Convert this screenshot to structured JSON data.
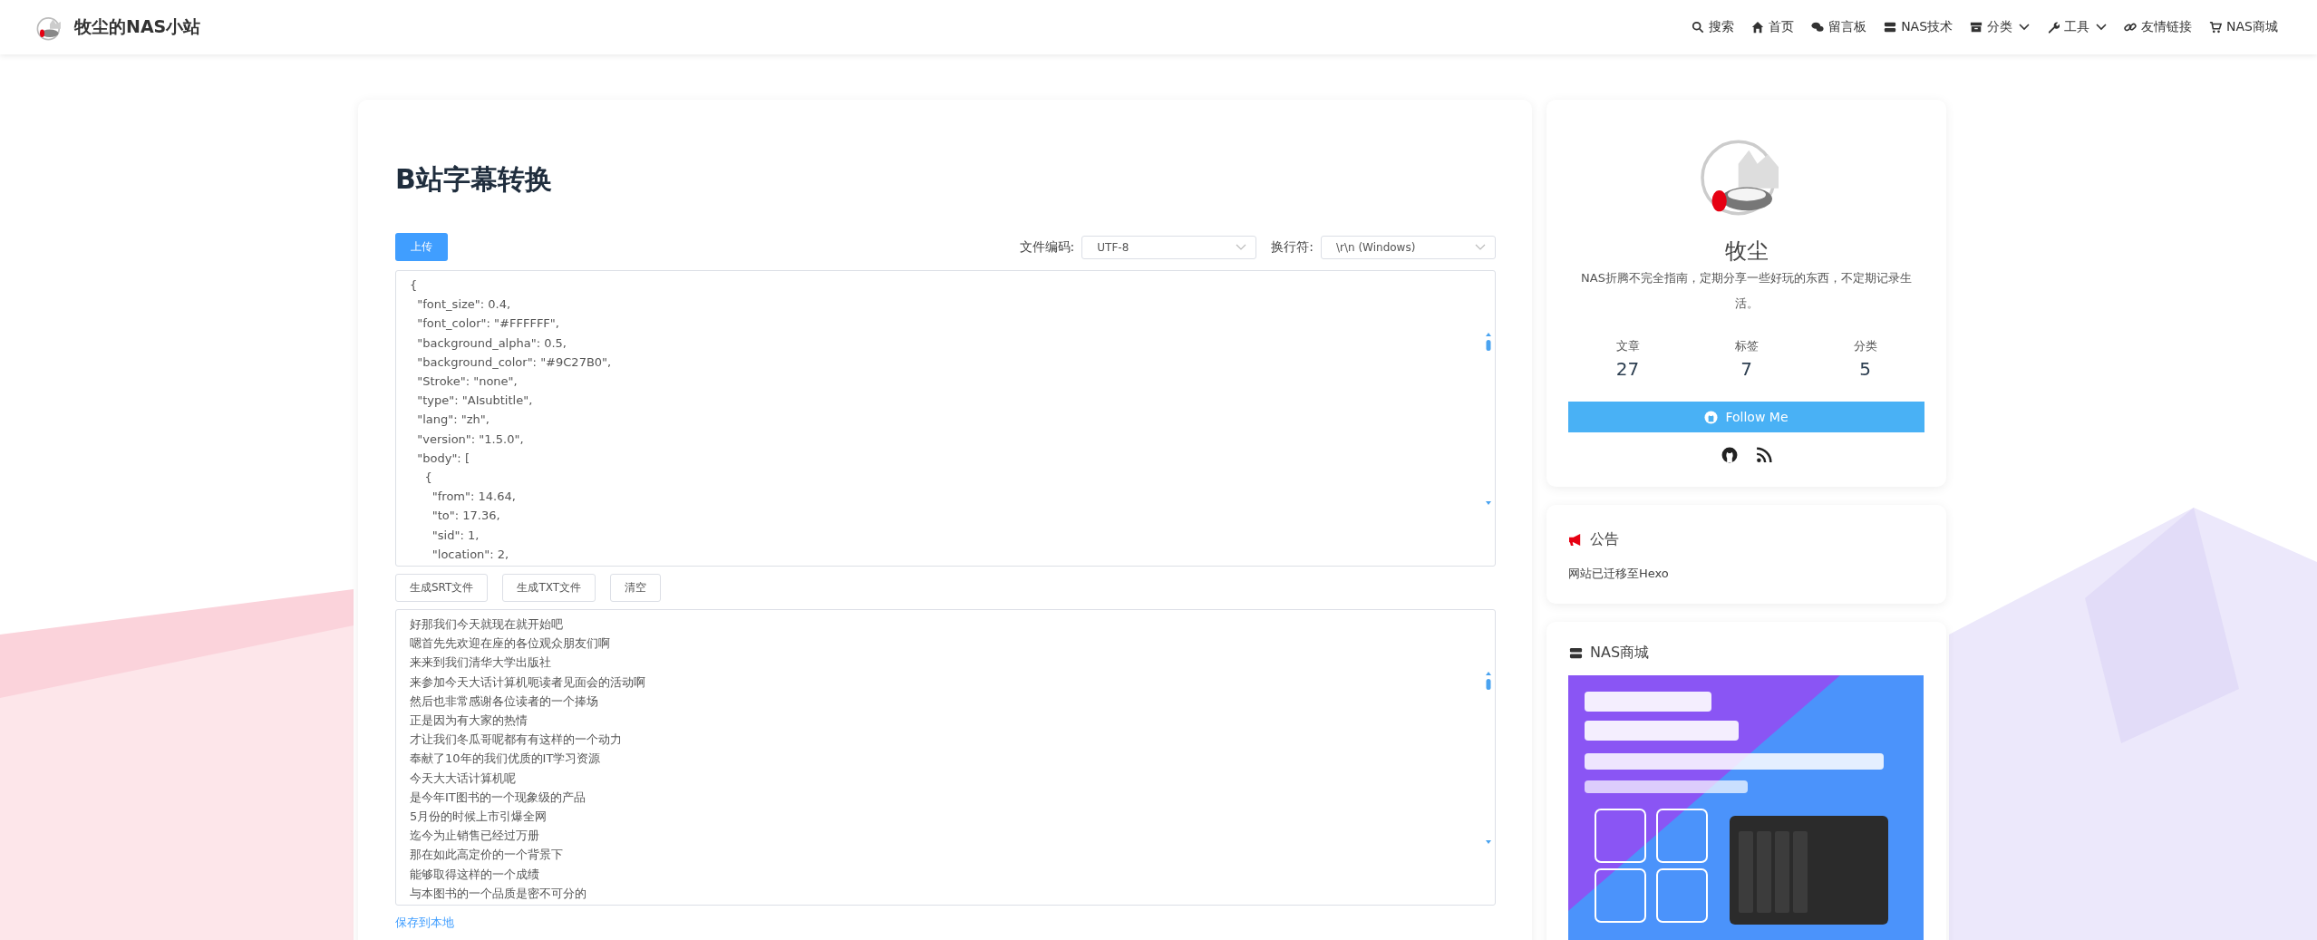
{
  "site": {
    "title": "牧尘的NAS小站"
  },
  "nav": [
    {
      "label": "搜索",
      "dropdown": false
    },
    {
      "label": "首页",
      "dropdown": false
    },
    {
      "label": "留言板",
      "dropdown": false
    },
    {
      "label": "NAS技术",
      "dropdown": false
    },
    {
      "label": "分类",
      "dropdown": true
    },
    {
      "label": "工具",
      "dropdown": true
    },
    {
      "label": "友情链接",
      "dropdown": false
    },
    {
      "label": "NAS商城",
      "dropdown": false
    }
  ],
  "main": {
    "title": "B站字幕转换",
    "upload_button": "上传",
    "encoding": {
      "label": "文件编码:",
      "value": "UTF-8"
    },
    "newline": {
      "label": "换行符:",
      "value": "\\r\\n (Windows)"
    },
    "input_lines": [
      "{",
      "  \"font_size\": 0.4,",
      "  \"font_color\": \"#FFFFFF\",",
      "  \"background_alpha\": 0.5,",
      "  \"background_color\": \"#9C27B0\",",
      "  \"Stroke\": \"none\",",
      "  \"type\": \"AIsubtitle\",",
      "  \"lang\": \"zh\",",
      "  \"version\": \"1.5.0\",",
      "  \"body\": [",
      "    {",
      "      \"from\": 14.64,",
      "      \"to\": 17.36,",
      "      \"sid\": 1,",
      "      \"location\": 2,"
    ],
    "actions": [
      "生成SRT文件",
      "生成TXT文件",
      "清空"
    ],
    "output_lines": [
      "好那我们今天就现在就开始吧",
      "嗯首先先欢迎在座的各位观众朋友们啊",
      "来来到我们清华大学出版社",
      "来参加今天大话计算机呃读者见面会的活动啊",
      "然后也非常感谢各位读者的一个捧场",
      "正是因为有大家的热情",
      "才让我们冬瓜哥呢都有有这样的一个动力",
      "奉献了10年的我们优质的IT学习资源",
      "今天大大话计算机呢",
      "是今年IT图书的一个现象级的产品",
      "5月份的时候上市引爆全网",
      "迄今为止销售已经过万册",
      "那在如此高定价的一个背景下",
      "能够取得这样的一个成绩",
      "与本图书的一个品质是密不可分的"
    ],
    "save_link": "保存到本地"
  },
  "profile": {
    "name": "牧尘",
    "bio": "NAS折腾不完全指南，定期分享一些好玩的东西，不定期记录生活。",
    "stats": [
      {
        "label": "文章",
        "value": "27"
      },
      {
        "label": "标签",
        "value": "7"
      },
      {
        "label": "分类",
        "value": "5"
      }
    ],
    "follow_button": "Follow Me"
  },
  "notice": {
    "title": "公告",
    "text": "网站已迁移至Hexo"
  },
  "shop": {
    "title": "NAS商城"
  }
}
